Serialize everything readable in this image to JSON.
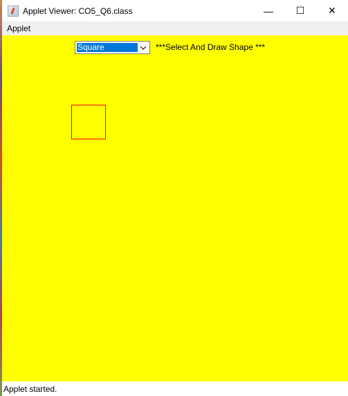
{
  "window": {
    "title": "Applet Viewer: CO5_Q6.class",
    "icon": "java-applet-icon",
    "controls": {
      "minimize": "—",
      "maximize": "☐",
      "close": "✕"
    }
  },
  "menubar": {
    "items": [
      {
        "label": "Applet"
      }
    ]
  },
  "applet": {
    "background": "#ffff00",
    "select": {
      "value": "Square"
    },
    "label": "***Select And Draw Shape ***",
    "shape": {
      "type": "square",
      "stroke": "#ff0000"
    }
  },
  "status": {
    "text": "Applet started."
  }
}
